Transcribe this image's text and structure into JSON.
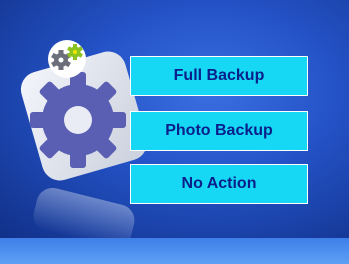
{
  "menu": {
    "items": [
      {
        "label": "Full Backup"
      },
      {
        "label": "Photo Backup"
      },
      {
        "label": "No Action"
      }
    ]
  },
  "icons": {
    "main": "gear-settings-icon",
    "badge": "small-gears-icon"
  },
  "colors": {
    "background": "#2453c7",
    "button": "#16d8f4",
    "button_text": "#0a1f8a",
    "bottom_bar": "#4d8ff0"
  }
}
